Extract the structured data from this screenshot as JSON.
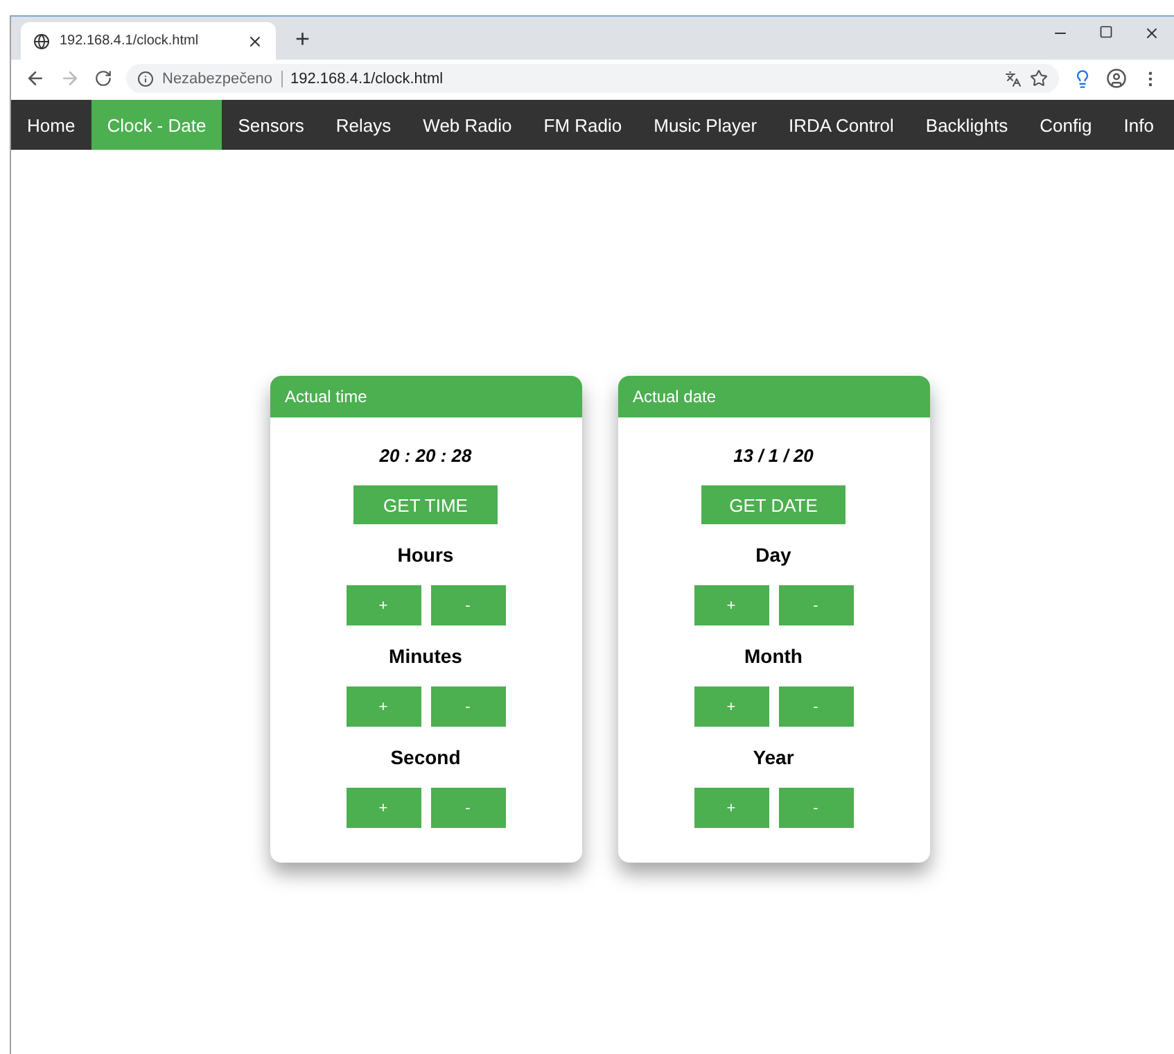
{
  "browser": {
    "tab_title": "192.168.4.1/clock.html",
    "new_tab": "+",
    "security": "Nezabezpečeno",
    "url": "192.168.4.1/clock.html"
  },
  "nav": [
    {
      "label": "Home",
      "selected": false
    },
    {
      "label": "Clock - Date",
      "selected": true
    },
    {
      "label": "Sensors",
      "selected": false
    },
    {
      "label": "Relays",
      "selected": false
    },
    {
      "label": "Web Radio",
      "selected": false
    },
    {
      "label": "FM Radio",
      "selected": false
    },
    {
      "label": "Music Player",
      "selected": false
    },
    {
      "label": "IRDA Control",
      "selected": false
    },
    {
      "label": "Backlights",
      "selected": false
    },
    {
      "label": "Config",
      "selected": false
    },
    {
      "label": "Info",
      "selected": false
    }
  ],
  "cards": [
    {
      "title": "Actual time",
      "value": "20 : 20 : 28",
      "button": "GET TIME",
      "controls": [
        {
          "label": "Hours",
          "plus": "+",
          "minus": "-"
        },
        {
          "label": "Minutes",
          "plus": "+",
          "minus": "-"
        },
        {
          "label": "Second",
          "plus": "+",
          "minus": "-"
        }
      ]
    },
    {
      "title": "Actual date",
      "value": "13 / 1 / 20",
      "button": "GET DATE",
      "controls": [
        {
          "label": "Day",
          "plus": "+",
          "minus": "-"
        },
        {
          "label": "Month",
          "plus": "+",
          "minus": "-"
        },
        {
          "label": "Year",
          "plus": "+",
          "minus": "-"
        }
      ]
    }
  ]
}
